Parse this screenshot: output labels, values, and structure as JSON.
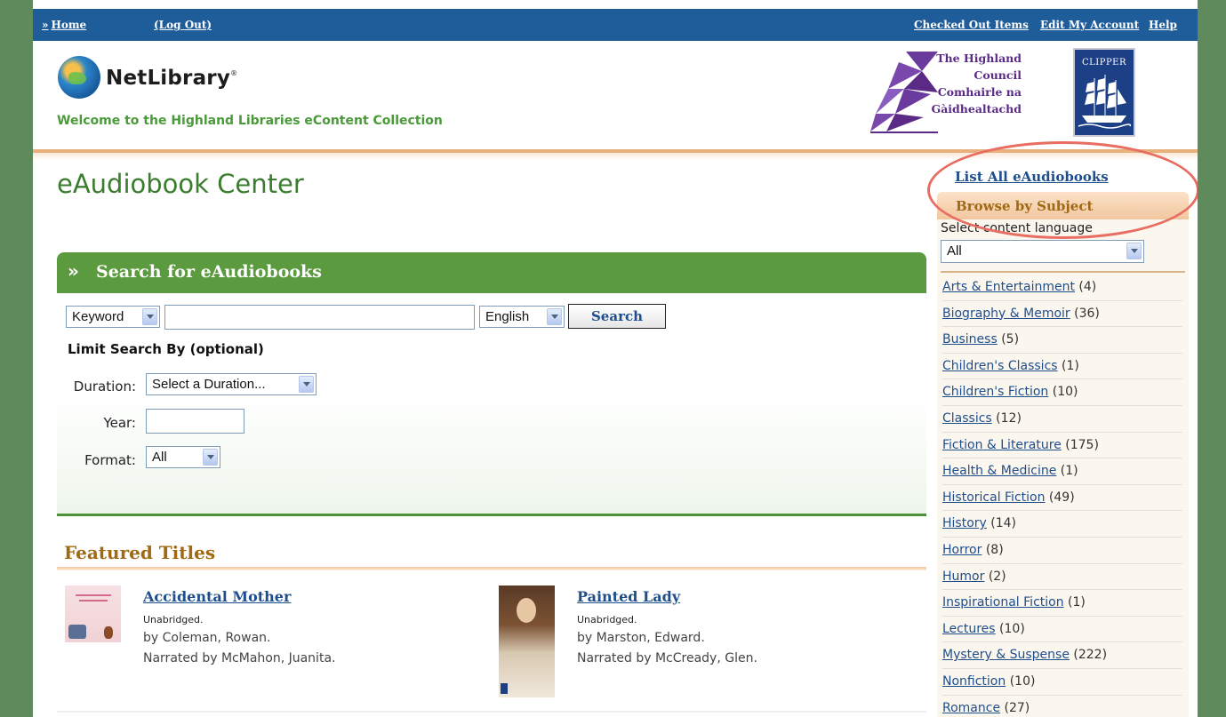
{
  "topnav": {
    "home": "Home",
    "logout": "(Log Out)",
    "checked_out": "Checked Out Items",
    "edit_account": "Edit My Account",
    "help": "Help"
  },
  "header": {
    "logo_text": "NetLibrary",
    "welcome": "Welcome to the Highland Libraries eContent Collection",
    "council_lines": [
      "The Highland",
      "Council",
      "Comhairle na",
      "Gàidhealtachd"
    ],
    "clipper_label": "CLIPPER"
  },
  "main": {
    "page_title": "eAudiobook Center",
    "search": {
      "header": "Search for eAudiobooks",
      "field_type": "Keyword",
      "language": "English",
      "button": "Search",
      "limit_label": "Limit Search By (optional)",
      "duration_label": "Duration:",
      "duration_value": "Select a Duration...",
      "year_label": "Year:",
      "format_label": "Format:",
      "format_value": "All"
    },
    "featured": {
      "title": "Featured Titles",
      "books": [
        {
          "title": "Accidental Mother",
          "edition": "Unabridged.",
          "author": "by Coleman, Rowan.",
          "narrator": "Narrated by McMahon, Juanita."
        },
        {
          "title": "Painted Lady",
          "edition": "Unabridged.",
          "author": "by Marston, Edward.",
          "narrator": "Narrated by McCready, Glen."
        }
      ]
    }
  },
  "sidebar": {
    "list_all": "List All eAudiobooks",
    "browse_by_subject": "Browse by Subject",
    "language_label": "Select content language",
    "language_value": "All",
    "subjects": [
      {
        "name": "Arts & Entertainment",
        "count": "(4)"
      },
      {
        "name": "Biography & Memoir",
        "count": "(36)"
      },
      {
        "name": "Business",
        "count": "(5)"
      },
      {
        "name": "Children's Classics",
        "count": "(1)"
      },
      {
        "name": "Children's Fiction",
        "count": "(10)"
      },
      {
        "name": "Classics",
        "count": "(12)"
      },
      {
        "name": "Fiction & Literature",
        "count": "(175)"
      },
      {
        "name": "Health & Medicine",
        "count": "(1)"
      },
      {
        "name": "Historical Fiction",
        "count": "(49)"
      },
      {
        "name": "History",
        "count": "(14)"
      },
      {
        "name": "Horror",
        "count": "(8)"
      },
      {
        "name": "Humor",
        "count": "(2)"
      },
      {
        "name": "Inspirational Fiction",
        "count": "(1)"
      },
      {
        "name": "Lectures",
        "count": "(10)"
      },
      {
        "name": "Mystery & Suspense",
        "count": "(222)"
      },
      {
        "name": "Nonfiction",
        "count": "(10)"
      },
      {
        "name": "Romance",
        "count": "(27)"
      }
    ]
  },
  "colors": {
    "nav_blue": "#1f5d9a",
    "green_accent": "#5b9a3e",
    "link_blue": "#1f4e8c",
    "highlight_ring": "#e86e63"
  }
}
